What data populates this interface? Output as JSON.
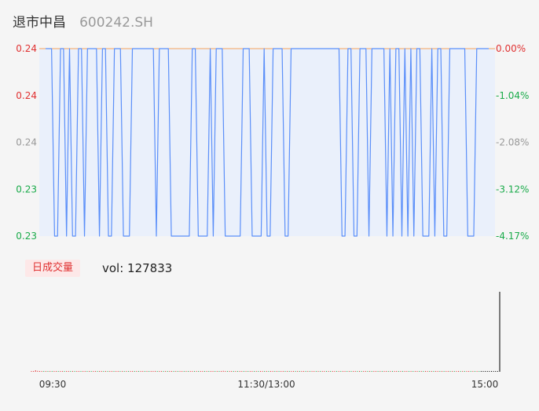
{
  "header": {
    "stock_name": "退市中昌",
    "stock_code": "600242.SH"
  },
  "volume_panel": {
    "badge_label": "日成交量",
    "vol_label": "vol: 127833"
  },
  "chart_data": [
    {
      "type": "line",
      "title": "",
      "x_ticks": [
        "09:30",
        "11:30/13:00",
        "15:00"
      ],
      "y_left_ticks": [
        "0.24",
        "0.24",
        "0.24",
        "0.23",
        "0.23"
      ],
      "y_right_ticks": [
        "0.00%",
        "-1.04%",
        "-2.08%",
        "-3.12%",
        "-4.17%"
      ],
      "ylim": [
        0.23,
        0.24
      ],
      "reference_price": 0.24,
      "series": [
        {
          "color": "#5b8ff9",
          "values": [
            0.24,
            0.24,
            0.24,
            0.23,
            0.23,
            0.24,
            0.24,
            0.23,
            0.24,
            0.23,
            0.23,
            0.24,
            0.24,
            0.23,
            0.24,
            0.24,
            0.24,
            0.24,
            0.23,
            0.24,
            0.24,
            0.23,
            0.23,
            0.24,
            0.24,
            0.24,
            0.23,
            0.23,
            0.23,
            0.24,
            0.24,
            0.24,
            0.24,
            0.24,
            0.24,
            0.24,
            0.24,
            0.23,
            0.24,
            0.24,
            0.24,
            0.24,
            0.23,
            0.23,
            0.23,
            0.23,
            0.23,
            0.23,
            0.23,
            0.24,
            0.24,
            0.23,
            0.23,
            0.23,
            0.23,
            0.24,
            0.23,
            0.24,
            0.24,
            0.24,
            0.23,
            0.23,
            0.23,
            0.23,
            0.23,
            0.23,
            0.24,
            0.24,
            0.24,
            0.23,
            0.23,
            0.23,
            0.23,
            0.24,
            0.23,
            0.23,
            0.24,
            0.24,
            0.24,
            0.24,
            0.23,
            0.23,
            0.24,
            0.24,
            0.24,
            0.24,
            0.24,
            0.24,
            0.24,
            0.24,
            0.24,
            0.24,
            0.24,
            0.24,
            0.24,
            0.24,
            0.24,
            0.24,
            0.24,
            0.23,
            0.23,
            0.24,
            0.24,
            0.23,
            0.23,
            0.24,
            0.24,
            0.24,
            0.23,
            0.24,
            0.24,
            0.24,
            0.24,
            0.24,
            0.23,
            0.24,
            0.23,
            0.24,
            0.24,
            0.23,
            0.24,
            0.23,
            0.24,
            0.23,
            0.24,
            0.24,
            0.23,
            0.23,
            0.23,
            0.24,
            0.23,
            0.24,
            0.24,
            0.23,
            0.23,
            0.24,
            0.24,
            0.24,
            0.24,
            0.24,
            0.24,
            0.23,
            0.23,
            0.23,
            0.24,
            0.24,
            0.24,
            0.24,
            0.24
          ]
        }
      ],
      "colors": {
        "line": "#5b8ff9",
        "reference": "#f5a35c",
        "up": "#e03131",
        "neutral": "#999999",
        "down": "#1aab4a",
        "fill": "#eaf0fb"
      }
    },
    {
      "type": "bar",
      "title": "",
      "series": [
        {
          "values": [
            150,
            320,
            2400,
            1500,
            900,
            600,
            250,
            180,
            300,
            200,
            350,
            400,
            150,
            120,
            280,
            250,
            300,
            200,
            150,
            400,
            300,
            200,
            150,
            100,
            350,
            250,
            150,
            200,
            120,
            300,
            250,
            200,
            150,
            100,
            350,
            200,
            150,
            120,
            200,
            300,
            250,
            200,
            150,
            300,
            200,
            120,
            150,
            350,
            300,
            200,
            150,
            100,
            200,
            150,
            250,
            300,
            150,
            120,
            200,
            100,
            1300,
            300,
            200,
            150,
            100,
            120,
            150,
            200,
            250,
            150,
            100,
            120,
            150,
            250,
            300,
            200,
            150,
            100,
            120,
            200,
            150,
            200,
            150,
            100,
            120,
            150,
            200,
            150,
            100,
            120,
            150,
            200,
            150,
            1500,
            300,
            200,
            150,
            120,
            100,
            150,
            200,
            150,
            100,
            120,
            150,
            200,
            150,
            100,
            120,
            300,
            200,
            150,
            100,
            120,
            150,
            200,
            150,
            100,
            120,
            150,
            200,
            300,
            150,
            120,
            100,
            150,
            200,
            300,
            150,
            120,
            100,
            150,
            200,
            150,
            120,
            150,
            200,
            150,
            100,
            120,
            150,
            200,
            150,
            100,
            120,
            150,
            200,
            150,
            120,
            150,
            200,
            300,
            150,
            120,
            100,
            150,
            200,
            150,
            120,
            150,
            200,
            150,
            120,
            150,
            200,
            150,
            300,
            150,
            120,
            100,
            150,
            200,
            150,
            120,
            150,
            200,
            150,
            120,
            500,
            150,
            120,
            150,
            200,
            150,
            120,
            100,
            150,
            200,
            150,
            120,
            150,
            200,
            150,
            120,
            100,
            150,
            200,
            300,
            150,
            120,
            100,
            150,
            200,
            150,
            120,
            150,
            200,
            150,
            120,
            100,
            150,
            200,
            150,
            120,
            150,
            200,
            150,
            120,
            100,
            150,
            200,
            150,
            120,
            150,
            200,
            150,
            300,
            127833
          ],
          "colors": [
            "#e03131",
            "#e03131",
            "#e03131",
            "#e03131",
            "#e03131",
            "#e03131",
            "#1aab4a",
            "#e03131",
            "#1aab4a",
            "#e03131",
            "#1aab4a",
            "#e03131",
            "#e03131",
            "#1aab4a",
            "#e03131",
            "#e03131",
            "#1aab4a",
            "#e03131",
            "#e03131",
            "#1aab4a",
            "#e03131",
            "#1aab4a",
            "#e03131",
            "#e03131",
            "#1aab4a",
            "#e03131",
            "#e03131",
            "#1aab4a",
            "#e03131",
            "#1aab4a",
            "#e03131",
            "#e03131",
            "#1aab4a",
            "#e03131",
            "#e03131",
            "#1aab4a",
            "#e03131",
            "#1aab4a",
            "#e03131",
            "#e03131",
            "#1aab4a",
            "#e03131",
            "#e03131",
            "#1aab4a",
            "#e03131",
            "#1aab4a",
            "#e03131",
            "#1aab4a",
            "#e03131",
            "#e03131",
            "#1aab4a",
            "#e03131",
            "#1aab4a",
            "#e03131",
            "#e03131",
            "#1aab4a",
            "#e03131",
            "#1aab4a",
            "#e03131",
            "#e03131",
            "#e03131",
            "#1aab4a",
            "#e03131",
            "#e03131",
            "#1aab4a",
            "#e03131",
            "#1aab4a",
            "#e03131",
            "#e03131",
            "#1aab4a",
            "#e03131",
            "#1aab4a",
            "#e03131",
            "#e03131",
            "#1aab4a",
            "#e03131",
            "#1aab4a",
            "#e03131",
            "#e03131",
            "#1aab4a",
            "#e03131",
            "#1aab4a",
            "#e03131",
            "#e03131",
            "#1aab4a",
            "#e03131",
            "#1aab4a",
            "#e03131",
            "#e03131",
            "#1aab4a",
            "#e03131",
            "#1aab4a",
            "#e03131",
            "#e03131",
            "#e03131",
            "#1aab4a",
            "#e03131",
            "#e03131",
            "#1aab4a",
            "#e03131",
            "#1aab4a",
            "#e03131",
            "#e03131",
            "#1aab4a",
            "#e03131",
            "#1aab4a",
            "#e03131",
            "#e03131",
            "#1aab4a",
            "#e03131",
            "#1aab4a",
            "#e03131",
            "#e03131",
            "#1aab4a",
            "#e03131",
            "#1aab4a",
            "#e03131",
            "#e03131",
            "#1aab4a",
            "#e03131",
            "#1aab4a",
            "#e03131",
            "#e03131",
            "#1aab4a",
            "#e03131",
            "#1aab4a",
            "#e03131",
            "#e03131",
            "#1aab4a",
            "#e03131",
            "#1aab4a",
            "#e03131",
            "#e03131",
            "#1aab4a",
            "#e03131",
            "#1aab4a",
            "#e03131",
            "#e03131",
            "#1aab4a",
            "#e03131",
            "#1aab4a",
            "#e03131",
            "#e03131",
            "#1aab4a",
            "#e03131",
            "#1aab4a",
            "#e03131",
            "#e03131",
            "#1aab4a",
            "#e03131",
            "#1aab4a",
            "#e03131",
            "#e03131",
            "#1aab4a",
            "#e03131",
            "#1aab4a",
            "#e03131",
            "#e03131",
            "#1aab4a",
            "#e03131",
            "#1aab4a",
            "#e03131",
            "#e03131",
            "#1aab4a",
            "#e03131",
            "#1aab4a",
            "#e03131",
            "#e03131",
            "#1aab4a",
            "#e03131",
            "#1aab4a",
            "#e03131",
            "#e03131",
            "#1aab4a",
            "#e03131",
            "#1aab4a",
            "#e03131",
            "#e03131",
            "#1aab4a",
            "#e03131",
            "#1aab4a",
            "#e03131",
            "#e03131",
            "#1aab4a",
            "#e03131",
            "#1aab4a",
            "#e03131",
            "#e03131",
            "#1aab4a",
            "#e03131",
            "#1aab4a",
            "#e03131",
            "#e03131",
            "#1aab4a",
            "#e03131",
            "#1aab4a",
            "#e03131",
            "#e03131",
            "#1aab4a",
            "#e03131",
            "#1aab4a",
            "#e03131",
            "#e03131",
            "#1aab4a",
            "#e03131",
            "#1aab4a",
            "#e03131",
            "#e03131",
            "#1aab4a",
            "#e03131",
            "#1aab4a",
            "#e03131",
            "#e03131",
            "#1aab4a",
            "#e03131",
            "#1aab4a",
            "#e03131",
            "#1aab4a"
          ]
        }
      ]
    }
  ]
}
